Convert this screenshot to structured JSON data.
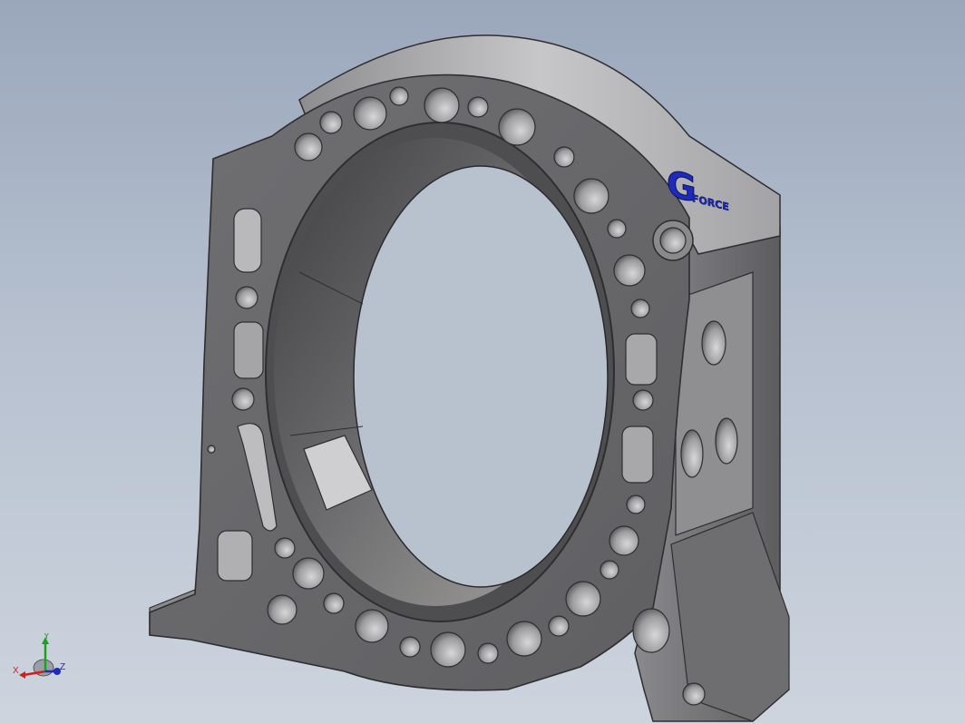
{
  "viewport": {
    "background_top": "#9aa7bb",
    "background_bottom": "#cdd4de"
  },
  "model": {
    "logo": {
      "letter": "G",
      "word": "FORCE",
      "color": "#1f2bb8"
    },
    "part_color": "#7c7c7f",
    "edge_color": "#2e2e30"
  },
  "triad": {
    "x_label": "X",
    "y_label": "Y",
    "z_label": "Z",
    "x_color": "#d11f1f",
    "y_color": "#1aa31a",
    "z_color": "#1f2bb8"
  }
}
